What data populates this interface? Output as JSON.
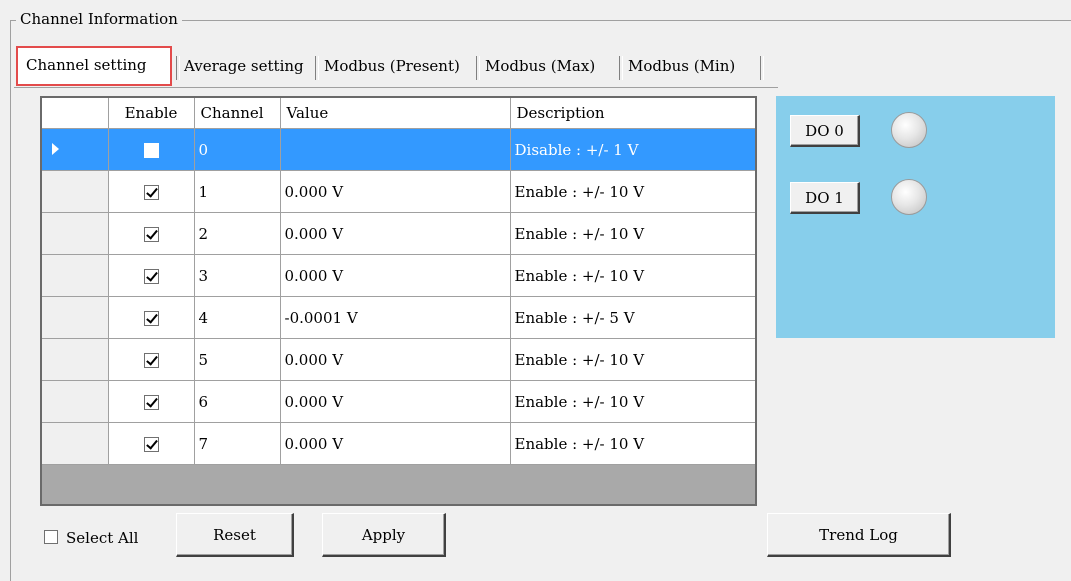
{
  "group": {
    "title": "Channel Information"
  },
  "tabs": [
    {
      "label": "Channel setting",
      "active": true
    },
    {
      "label": "Average setting",
      "active": false
    },
    {
      "label": "Modbus (Present)",
      "active": false
    },
    {
      "label": "Modbus (Max)",
      "active": false
    },
    {
      "label": "Modbus (Min)",
      "active": false
    }
  ],
  "grid": {
    "columns": {
      "enable": "Enable",
      "channel": "Channel",
      "value": "Value",
      "description": "Description"
    },
    "rows": [
      {
        "enabled": false,
        "channel": "0",
        "value": "",
        "description": "Disable : +/- 1 V",
        "selected": true
      },
      {
        "enabled": true,
        "channel": "1",
        "value": "0.000 V",
        "description": "Enable : +/- 10 V",
        "selected": false
      },
      {
        "enabled": true,
        "channel": "2",
        "value": "0.000 V",
        "description": "Enable : +/- 10 V",
        "selected": false
      },
      {
        "enabled": true,
        "channel": "3",
        "value": "0.000 V",
        "description": "Enable : +/- 10 V",
        "selected": false
      },
      {
        "enabled": true,
        "channel": "4",
        "value": "-0.0001 V",
        "description": "Enable : +/- 5 V",
        "selected": false
      },
      {
        "enabled": true,
        "channel": "5",
        "value": "0.000 V",
        "description": "Enable : +/- 10 V",
        "selected": false
      },
      {
        "enabled": true,
        "channel": "6",
        "value": "0.000 V",
        "description": "Enable : +/- 10 V",
        "selected": false
      },
      {
        "enabled": true,
        "channel": "7",
        "value": "0.000 V",
        "description": "Enable : +/- 10 V",
        "selected": false
      }
    ]
  },
  "do_panel": {
    "color": "#87ceeb",
    "outputs": [
      {
        "label": "DO 0",
        "led_state": "off"
      },
      {
        "label": "DO 1",
        "led_state": "off"
      }
    ]
  },
  "controls": {
    "select_all_label": "Select All",
    "select_all_checked": false,
    "reset_label": "Reset",
    "apply_label": "Apply",
    "trend_log_label": "Trend Log"
  },
  "colors": {
    "selection": "#3399ff",
    "active_tab_outline": "#e34b4b"
  }
}
